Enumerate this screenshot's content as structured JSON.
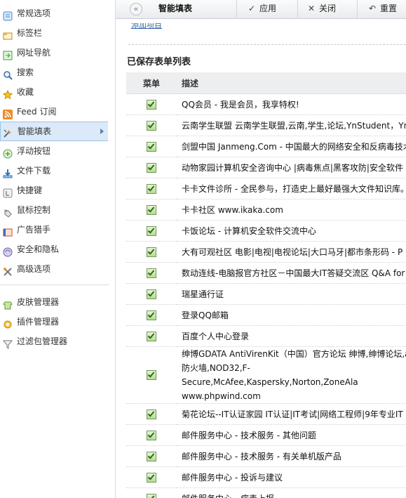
{
  "sidebar": {
    "items": [
      {
        "label": "常规选项",
        "icon": "settings-icon"
      },
      {
        "label": "标签栏",
        "icon": "tab-icon"
      },
      {
        "label": "网址导航",
        "icon": "nav-icon"
      },
      {
        "label": "搜索",
        "icon": "search-icon"
      },
      {
        "label": "收藏",
        "icon": "star-icon"
      },
      {
        "label": "Feed 订阅",
        "icon": "rss-icon"
      },
      {
        "label": "智能填表",
        "icon": "autofill-icon"
      },
      {
        "label": "浮动按钮",
        "icon": "float-button-icon"
      },
      {
        "label": "文件下载",
        "icon": "download-icon"
      },
      {
        "label": "快捷键",
        "icon": "shortcut-icon"
      },
      {
        "label": "鼠标控制",
        "icon": "mouse-gesture-icon"
      },
      {
        "label": "广告猎手",
        "icon": "ad-hunter-icon"
      },
      {
        "label": "安全和隐私",
        "icon": "security-icon"
      },
      {
        "label": "高级选项",
        "icon": "tools-icon"
      }
    ],
    "extra_items": [
      {
        "label": "皮肤管理器",
        "icon": "skin-icon"
      },
      {
        "label": "插件管理器",
        "icon": "plugin-icon"
      },
      {
        "label": "过滤包管理器",
        "icon": "filter-icon"
      }
    ],
    "active_index": 6
  },
  "toolbar": {
    "back_glyph": "«",
    "title": "智能填表",
    "apply_label": "应用",
    "close_label": "关闭",
    "reset_label": "重置"
  },
  "main": {
    "cut_link": "添加项目",
    "section_title": "已保存表单列表",
    "columns": {
      "menu": "菜单",
      "desc": "描述"
    },
    "rows": [
      {
        "checked": true,
        "desc": "QQ会员 - 我是会员，我享特权!"
      },
      {
        "checked": true,
        "desc": "云南学生联盟 云南学生联盟,云南,学生,论坛,YnStudent，Yn"
      },
      {
        "checked": true,
        "desc": "剑盟中国 Janmeng.Com - 中国最大的网络安全和反病毒技术"
      },
      {
        "checked": true,
        "desc": "动物家园计算机安全咨询中心 |病毒焦点|黑客攻防|安全软件"
      },
      {
        "checked": true,
        "desc": "卡卡文件诊所 - 全民参与，打造史上最好最强大文件知识库。"
      },
      {
        "checked": true,
        "desc": "卡卡社区 www.ikaka.com"
      },
      {
        "checked": true,
        "desc": "卡饭论坛 - 计算机安全软件交流中心"
      },
      {
        "checked": true,
        "desc": "大有可观社区 电影|电视|电视论坛|大口马牙|都市条形码 - P"
      },
      {
        "checked": true,
        "desc": "数动连线-电脑报官方社区－中国最大IT答疑交流区 Q&A for"
      },
      {
        "checked": true,
        "desc": "瑞星通行证"
      },
      {
        "checked": true,
        "desc": "登录QQ邮箱"
      },
      {
        "checked": true,
        "desc": "百度个人中心登录"
      },
      {
        "checked": true,
        "tall": true,
        "desc": "绅博GDATA AntiVirenKit（中国）官方论坛 绅博,绅博论坛,a 防火墙,NOD32,F-Secure,McAfee,Kaspersky,Norton,ZoneAla www.phpwind.com"
      },
      {
        "checked": true,
        "desc": "菊花论坛--IT认证家园 IT认证|IT考试|网络工程师|9年专业IT"
      },
      {
        "checked": true,
        "desc": "邮件服务中心 - 技术服务 - 其他问题"
      },
      {
        "checked": true,
        "desc": "邮件服务中心 - 技术服务 - 有关单机版产品"
      },
      {
        "checked": true,
        "desc": "邮件服务中心 - 投诉与建议"
      },
      {
        "checked": true,
        "desc": "邮件服务中心 - 病毒上报"
      }
    ]
  }
}
